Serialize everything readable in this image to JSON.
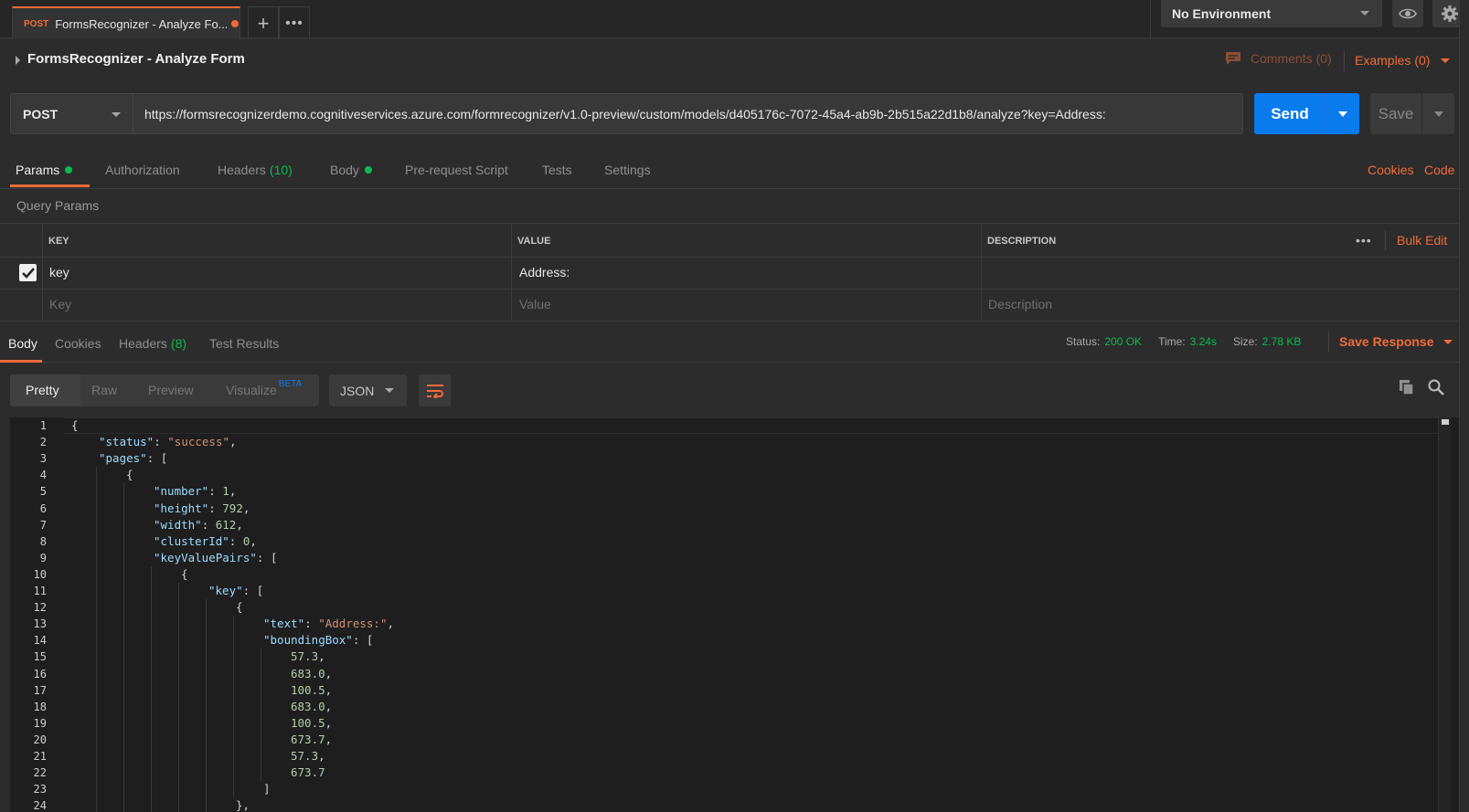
{
  "tabbar": {
    "active_tab": {
      "method": "POST",
      "title": "FormsRecognizer - Analyze Fo..."
    },
    "add_tab_label": "+",
    "more_label": "•••",
    "environment": "No Environment"
  },
  "request": {
    "title": "FormsRecognizer - Analyze Form",
    "comments": "Comments (0)",
    "examples": "Examples (0)",
    "method": "POST",
    "url": "https://formsrecognizerdemo.cognitiveservices.azure.com/formrecognizer/v1.0-preview/custom/models/d405176c-7072-45a4-ab9b-2b515a22d1b8/analyze?key=Address:",
    "send_label": "Send",
    "save_label": "Save"
  },
  "request_tabs": {
    "params": "Params",
    "authorization": "Authorization",
    "headers": "Headers",
    "headers_count": "(10)",
    "body": "Body",
    "pre_request": "Pre-request Script",
    "tests": "Tests",
    "settings": "Settings",
    "cookies_link": "Cookies",
    "code_link": "Code"
  },
  "params": {
    "section_label": "Query Params",
    "columns": [
      "KEY",
      "VALUE",
      "DESCRIPTION"
    ],
    "more_label": "•••",
    "bulk_edit": "Bulk Edit",
    "rows": [
      {
        "checked": true,
        "key": "key",
        "value": "Address:",
        "description": ""
      }
    ],
    "placeholders": {
      "key": "Key",
      "value": "Value",
      "description": "Description"
    }
  },
  "response": {
    "tabs": {
      "body": "Body",
      "cookies": "Cookies",
      "headers": "Headers",
      "headers_count": "(8)",
      "test_results": "Test Results"
    },
    "status_label": "Status:",
    "status_value": "200 OK",
    "time_label": "Time:",
    "time_value": "3.24s",
    "size_label": "Size:",
    "size_value": "2.78 KB",
    "save_response": "Save Response",
    "views": {
      "pretty": "Pretty",
      "raw": "Raw",
      "preview": "Preview",
      "visualize": "Visualize",
      "beta": "BETA"
    },
    "format": "JSON"
  },
  "editor": {
    "lines": [
      {
        "n": "1",
        "indent": 0,
        "parts": [
          [
            "p",
            "{"
          ]
        ]
      },
      {
        "n": "2",
        "indent": 1,
        "parts": [
          [
            "k",
            "\"status\""
          ],
          [
            "p",
            ": "
          ],
          [
            "s",
            "\"success\""
          ],
          [
            "p",
            ","
          ]
        ]
      },
      {
        "n": "3",
        "indent": 1,
        "parts": [
          [
            "k",
            "\"pages\""
          ],
          [
            "p",
            ": ["
          ]
        ]
      },
      {
        "n": "4",
        "indent": 2,
        "parts": [
          [
            "p",
            "{"
          ]
        ]
      },
      {
        "n": "5",
        "indent": 3,
        "parts": [
          [
            "k",
            "\"number\""
          ],
          [
            "p",
            ": "
          ],
          [
            "n",
            "1"
          ],
          [
            "p",
            ","
          ]
        ]
      },
      {
        "n": "6",
        "indent": 3,
        "parts": [
          [
            "k",
            "\"height\""
          ],
          [
            "p",
            ": "
          ],
          [
            "n",
            "792"
          ],
          [
            "p",
            ","
          ]
        ]
      },
      {
        "n": "7",
        "indent": 3,
        "parts": [
          [
            "k",
            "\"width\""
          ],
          [
            "p",
            ": "
          ],
          [
            "n",
            "612"
          ],
          [
            "p",
            ","
          ]
        ]
      },
      {
        "n": "8",
        "indent": 3,
        "parts": [
          [
            "k",
            "\"clusterId\""
          ],
          [
            "p",
            ": "
          ],
          [
            "n",
            "0"
          ],
          [
            "p",
            ","
          ]
        ]
      },
      {
        "n": "9",
        "indent": 3,
        "parts": [
          [
            "k",
            "\"keyValuePairs\""
          ],
          [
            "p",
            ": ["
          ]
        ]
      },
      {
        "n": "10",
        "indent": 4,
        "parts": [
          [
            "p",
            "{"
          ]
        ]
      },
      {
        "n": "11",
        "indent": 5,
        "parts": [
          [
            "k",
            "\"key\""
          ],
          [
            "p",
            ": ["
          ]
        ]
      },
      {
        "n": "12",
        "indent": 6,
        "parts": [
          [
            "p",
            "{"
          ]
        ]
      },
      {
        "n": "13",
        "indent": 7,
        "parts": [
          [
            "k",
            "\"text\""
          ],
          [
            "p",
            ": "
          ],
          [
            "s",
            "\"Address:\""
          ],
          [
            "p",
            ","
          ]
        ]
      },
      {
        "n": "14",
        "indent": 7,
        "parts": [
          [
            "k",
            "\"boundingBox\""
          ],
          [
            "p",
            ": ["
          ]
        ]
      },
      {
        "n": "15",
        "indent": 8,
        "parts": [
          [
            "n",
            "57.3"
          ],
          [
            "p",
            ","
          ]
        ]
      },
      {
        "n": "16",
        "indent": 8,
        "parts": [
          [
            "n",
            "683.0"
          ],
          [
            "p",
            ","
          ]
        ]
      },
      {
        "n": "17",
        "indent": 8,
        "parts": [
          [
            "n",
            "100.5"
          ],
          [
            "p",
            ","
          ]
        ]
      },
      {
        "n": "18",
        "indent": 8,
        "parts": [
          [
            "n",
            "683.0"
          ],
          [
            "p",
            ","
          ]
        ]
      },
      {
        "n": "19",
        "indent": 8,
        "parts": [
          [
            "n",
            "100.5"
          ],
          [
            "p",
            ","
          ]
        ]
      },
      {
        "n": "20",
        "indent": 8,
        "parts": [
          [
            "n",
            "673.7"
          ],
          [
            "p",
            ","
          ]
        ]
      },
      {
        "n": "21",
        "indent": 8,
        "parts": [
          [
            "n",
            "57.3"
          ],
          [
            "p",
            ","
          ]
        ]
      },
      {
        "n": "22",
        "indent": 8,
        "parts": [
          [
            "n",
            "673.7"
          ]
        ]
      },
      {
        "n": "23",
        "indent": 7,
        "parts": [
          [
            "p",
            "]"
          ]
        ]
      },
      {
        "n": "24",
        "indent": 6,
        "parts": [
          [
            "p",
            "},"
          ]
        ]
      }
    ]
  },
  "icons": {
    "env_caret": "chevron-down-icon",
    "eye": "eye-icon",
    "gear": "gear-icon",
    "comments": "comment-icon",
    "wrap": "wrap-lines-icon",
    "copy": "copy-icon",
    "search": "search-icon"
  },
  "colors": {
    "accent": "#f26b3a",
    "send": "#097bed",
    "success": "#0cbb52",
    "json_key": "#9cdcfe",
    "json_string": "#ce9178",
    "json_number": "#b5cea8"
  }
}
